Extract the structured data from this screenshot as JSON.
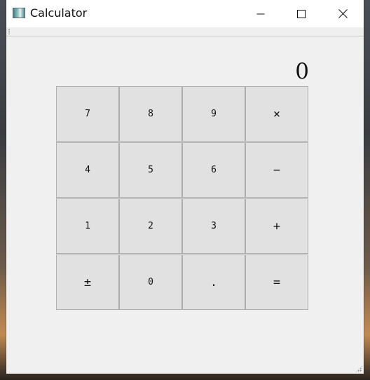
{
  "window": {
    "title": "Calculator"
  },
  "titlebar_buttons": {
    "minimize": "minimize-icon",
    "maximize": "maximize-icon",
    "close": "close-icon"
  },
  "display": {
    "value": "0"
  },
  "keys": {
    "row1": [
      "7",
      "8",
      "9",
      "×"
    ],
    "row2": [
      "4",
      "5",
      "6",
      "−"
    ],
    "row3": [
      "1",
      "2",
      "3",
      "+"
    ],
    "row4": [
      "±",
      "0",
      ".",
      "="
    ]
  },
  "colors": {
    "window_bg": "#f0f0f0",
    "titlebar_bg": "#ffffff",
    "key_bg": "#e1e1e1",
    "key_border": "#adadad"
  }
}
